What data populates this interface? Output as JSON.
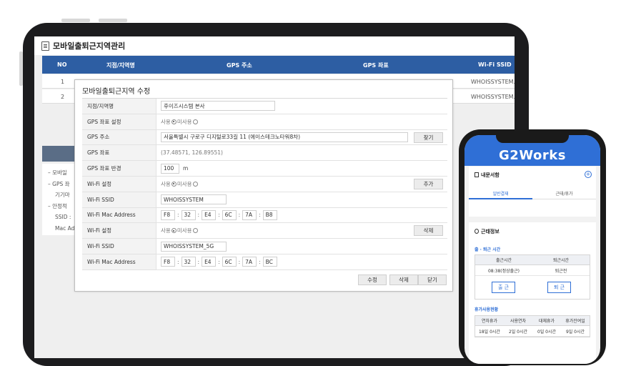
{
  "admin": {
    "page_title": "모바일출퇴근지역관리",
    "columns": [
      "NO",
      "지점/지역명",
      "GPS 주소",
      "GPS 좌표",
      "Wi-Fi SSID"
    ],
    "rows": [
      {
        "no": "1",
        "ssid": "WHOISSYSTEM..."
      },
      {
        "no": "2",
        "ssid": "WHOISSYSTEM..."
      }
    ],
    "notes": [
      "– 모바일",
      "– GPS 좌",
      "기기마",
      "– 안정적",
      "SSID :",
      "Mac Ad"
    ]
  },
  "modal": {
    "title": "모바일출퇴근지역 수정",
    "labels": {
      "branch_name": "지점/지역명",
      "gps_setting": "GPS 좌표 설정",
      "gps_address": "GPS 주소",
      "gps_coord": "GPS 좌표",
      "gps_radius": "GPS 좌표 반경",
      "wifi_setting": "Wi-Fi 설정",
      "wifi_ssid": "Wi-Fi SSID",
      "wifi_mac": "Wi-Fi Mac Address"
    },
    "branch_name": "후이즈시스템 본사",
    "use_label": "사용",
    "unused_label": "미사용",
    "gps_address": "서울특별시 구로구 디지털로33길 11 (에이스테크노타워8차)",
    "search_button": "찾기",
    "gps_coord": "(37.48571, 126.89551)",
    "radius_value": "100",
    "radius_unit": "m",
    "add_button": "추가",
    "delete_row_button": "삭제",
    "wifi1": {
      "ssid": "WHOISSYSTEM",
      "mac": [
        "F8",
        "32",
        "E4",
        "6C",
        "7A",
        "B8"
      ]
    },
    "wifi2": {
      "ssid": "WHOISSYSTEM_5G",
      "mac": [
        "F8",
        "32",
        "E4",
        "6C",
        "7A",
        "BC"
      ]
    },
    "footer": {
      "edit": "수정",
      "delete": "삭제",
      "close": "닫기"
    }
  },
  "phone": {
    "logo": "G2Works",
    "card1_title": "내문서함",
    "tab_general": "일반결재",
    "tab_attendance": "근태/휴가",
    "card2_title": "근태정보",
    "commute_label": "출 · 퇴근 시간",
    "commute_headers": [
      "출근시간",
      "퇴근시간"
    ],
    "commute_values": [
      "08:38(정상출근)",
      "퇴근전"
    ],
    "checkin_button": "출 근",
    "checkout_button": "퇴 근",
    "vacation_label": "휴가사용현황",
    "vacation_headers": [
      "연차휴가",
      "사용연차",
      "대체휴가",
      "휴가잔여일"
    ],
    "vacation_values": [
      "18일 0시간",
      "2일 0시간",
      "0일 0시간",
      "9일 0시간"
    ]
  },
  "colors": {
    "header_blue": "#2d5ea3",
    "brand_blue": "#2f6fd6"
  }
}
